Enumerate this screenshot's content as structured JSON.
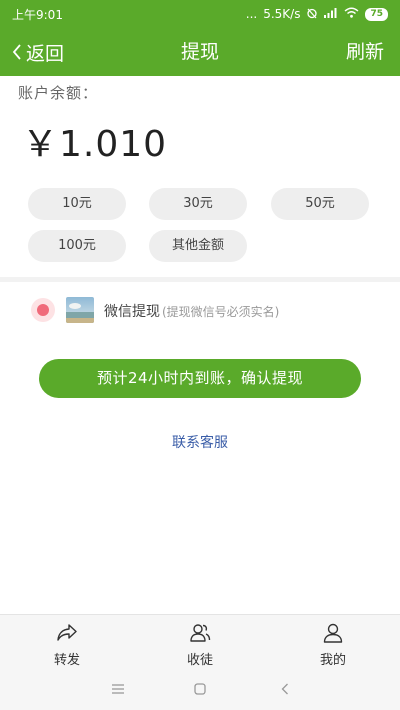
{
  "status_bar": {
    "time": "上午9:01",
    "dots": "...",
    "net_speed": "5.5K/s",
    "battery": "75"
  },
  "nav": {
    "back_label": "返回",
    "title": "提现",
    "refresh_label": "刷新"
  },
  "balance": {
    "label": "账户余额：",
    "amount": "￥1.010"
  },
  "amount_options": [
    "10元",
    "30元",
    "50元",
    "100元",
    "其他金额"
  ],
  "payment_method": {
    "label": "微信提现",
    "note": "(提现微信号必须实名)"
  },
  "confirm_button": "预计24小时内到账，确认提现",
  "contact_link": "联系客服",
  "tabs": [
    {
      "label": "转发",
      "icon": "share-icon"
    },
    {
      "label": "收徒",
      "icon": "people-icon"
    },
    {
      "label": "我的",
      "icon": "person-icon"
    }
  ],
  "colors": {
    "accent": "#5aaa2a",
    "radio": "#f06a7a",
    "link": "#3b5ea8"
  }
}
